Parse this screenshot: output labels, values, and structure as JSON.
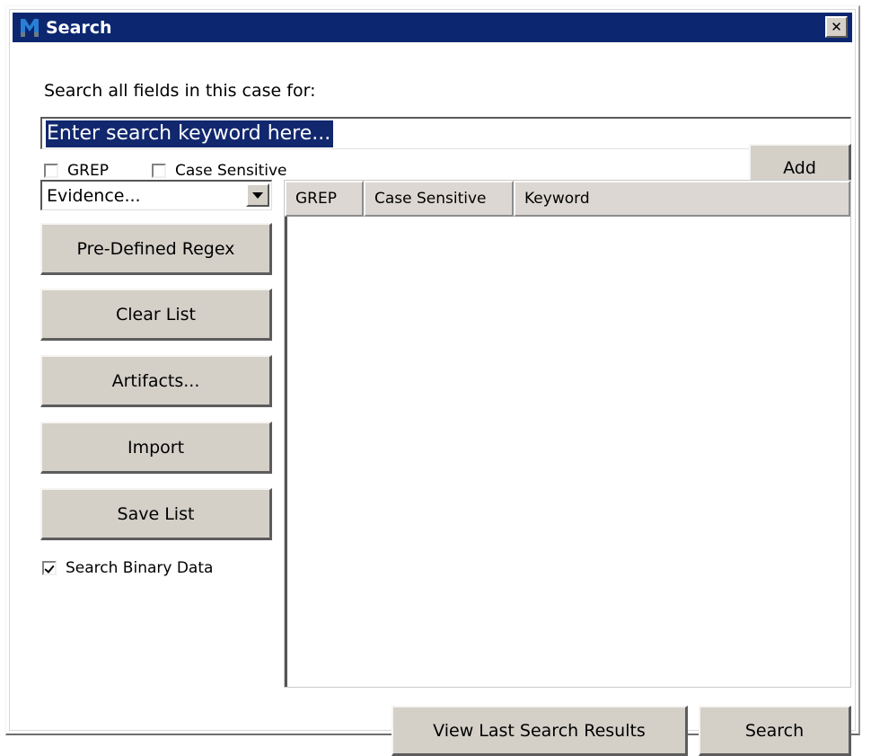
{
  "window": {
    "title": "Search",
    "app_icon": "magnet-m-logo-icon",
    "close_label": "✕",
    "titlebar_color": "#0c2770"
  },
  "search": {
    "prompt_label": "Search all fields in this case for:",
    "keyword_value": "Enter search keyword here...",
    "keyword_placeholder": "Enter search keyword here...",
    "selection_color": "#11276e"
  },
  "options": {
    "grep": {
      "label": "GREP",
      "checked": false
    },
    "case_sensitive": {
      "label": "Case Sensitive",
      "checked": false
    },
    "search_binary_data": {
      "label": "Search Binary Data",
      "checked": true
    }
  },
  "add_button": {
    "label": "Add"
  },
  "evidence_combo": {
    "selected": "Evidence...",
    "arrow_icon": "chevron-down-icon"
  },
  "side_buttons": [
    {
      "label": "Pre-Defined Regex"
    },
    {
      "label": "Clear List"
    },
    {
      "label": "Artifacts..."
    },
    {
      "label": "Import"
    },
    {
      "label": "Save List"
    }
  ],
  "keyword_list": {
    "columns": [
      {
        "label": "GREP"
      },
      {
        "label": "Case Sensitive"
      },
      {
        "label": "Keyword"
      }
    ],
    "rows": []
  },
  "footer_buttons": {
    "view_last_results": {
      "label": "View Last Search Results"
    },
    "search": {
      "label": "Search"
    }
  }
}
